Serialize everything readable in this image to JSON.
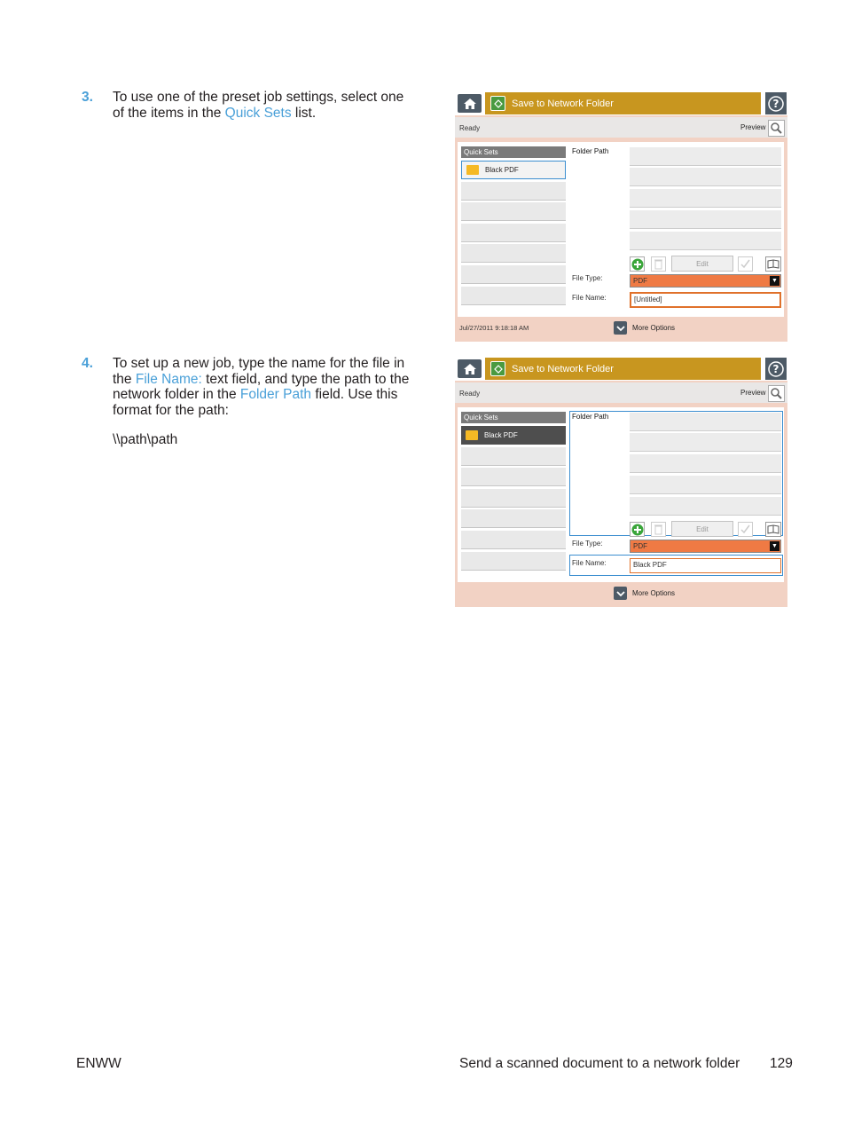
{
  "step3": {
    "number": "3.",
    "text_a": "To use one of the preset job settings, select one of the items in the ",
    "link": "Quick Sets",
    "text_b": " list."
  },
  "step4": {
    "number": "4.",
    "text_a": "To set up a new job, type the name for the file in the ",
    "link1": "File Name:",
    "text_b": " text field, and type the path to the network folder in the ",
    "link2": "Folder Path",
    "text_c": " field. Use this format for the path:",
    "path": "\\\\path\\path"
  },
  "screen1": {
    "title": "Save to Network Folder",
    "status": "Ready",
    "preview_label": "Preview",
    "quick_sets_header": "Quick Sets",
    "quick_set_item": "Black PDF",
    "folder_path_label": "Folder Path",
    "edit_label": "Edit",
    "file_type_label": "File Type:",
    "file_type_value": "PDF",
    "file_name_label": "File Name:",
    "file_name_value": "[Untitled]",
    "datetime": "Jul/27/2011 9:18:18 AM",
    "more_options": "More Options"
  },
  "screen2": {
    "title": "Save to Network Folder",
    "status": "Ready",
    "preview_label": "Preview",
    "quick_sets_header": "Quick Sets",
    "quick_set_item": "Black PDF",
    "folder_path_label": "Folder Path",
    "edit_label": "Edit",
    "file_type_label": "File Type:",
    "file_type_value": "PDF",
    "file_name_label": "File Name:",
    "file_name_value": "Black PDF",
    "more_options": "More Options"
  },
  "footer": {
    "left": "ENWW",
    "section": "Send a scanned document to a network folder",
    "page": "129"
  },
  "colors": {
    "link": "#4aa0d8",
    "title_bar": "#c8961f",
    "panel_bg": "#f2d2c4",
    "file_type_select": "#ef7a44"
  }
}
